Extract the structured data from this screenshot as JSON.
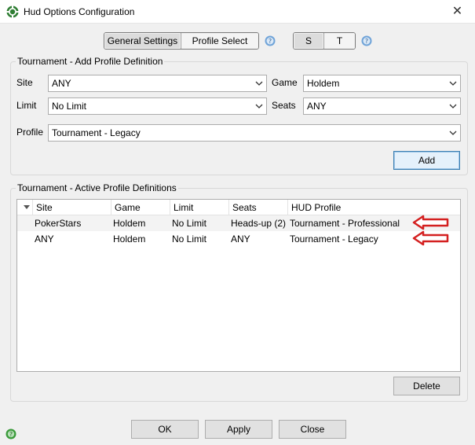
{
  "window": {
    "title": "Hud Options Configuration",
    "close_glyph": "✕"
  },
  "header": {
    "tabs": [
      {
        "label": "General Settings",
        "active": true
      },
      {
        "label": "Profile Select",
        "active": false
      }
    ],
    "modes": [
      {
        "label": "S",
        "active": true
      },
      {
        "label": "T",
        "active": false
      }
    ]
  },
  "add_section": {
    "title": "Tournament - Add Profile Definition",
    "site": {
      "label": "Site",
      "value": "ANY"
    },
    "game": {
      "label": "Game",
      "value": "Holdem"
    },
    "limit": {
      "label": "Limit",
      "value": "No Limit"
    },
    "seats": {
      "label": "Seats",
      "value": "ANY"
    },
    "profile": {
      "label": "Profile",
      "value": "Tournament - Legacy"
    },
    "add_label": "Add"
  },
  "active_section": {
    "title": "Tournament - Active Profile Definitions",
    "columns": [
      "Site",
      "Game",
      "Limit",
      "Seats",
      "HUD Profile"
    ],
    "rows": [
      [
        "PokerStars",
        "Holdem",
        "No Limit",
        "Heads-up (2)",
        "Tournament - Professional"
      ],
      [
        "ANY",
        "Holdem",
        "No Limit",
        "ANY",
        "Tournament - Legacy"
      ]
    ],
    "delete_label": "Delete"
  },
  "footer": {
    "ok_label": "OK",
    "apply_label": "Apply",
    "close_label": "Close"
  },
  "colors": {
    "accent_blue": "#3c7fb1",
    "annotation_red": "#d42020",
    "icon_green": "#3a9a3a"
  },
  "icons": [
    "app-icon",
    "help-icon",
    "chevron-down-icon",
    "sort-icon",
    "red-arrow-icon",
    "status-icon"
  ]
}
